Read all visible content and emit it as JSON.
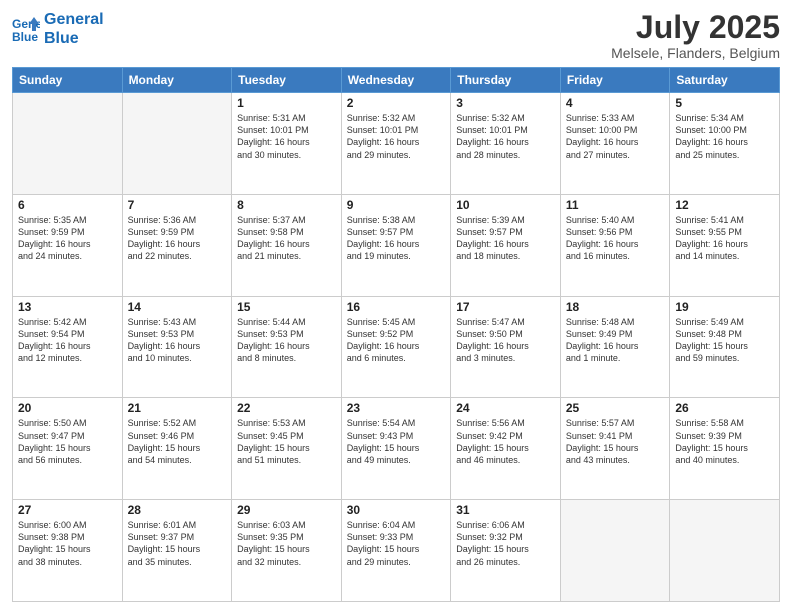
{
  "header": {
    "logo_line1": "General",
    "logo_line2": "Blue",
    "month": "July 2025",
    "location": "Melsele, Flanders, Belgium"
  },
  "weekdays": [
    "Sunday",
    "Monday",
    "Tuesday",
    "Wednesday",
    "Thursday",
    "Friday",
    "Saturday"
  ],
  "weeks": [
    [
      {
        "day": "",
        "info": ""
      },
      {
        "day": "",
        "info": ""
      },
      {
        "day": "1",
        "info": "Sunrise: 5:31 AM\nSunset: 10:01 PM\nDaylight: 16 hours\nand 30 minutes."
      },
      {
        "day": "2",
        "info": "Sunrise: 5:32 AM\nSunset: 10:01 PM\nDaylight: 16 hours\nand 29 minutes."
      },
      {
        "day": "3",
        "info": "Sunrise: 5:32 AM\nSunset: 10:01 PM\nDaylight: 16 hours\nand 28 minutes."
      },
      {
        "day": "4",
        "info": "Sunrise: 5:33 AM\nSunset: 10:00 PM\nDaylight: 16 hours\nand 27 minutes."
      },
      {
        "day": "5",
        "info": "Sunrise: 5:34 AM\nSunset: 10:00 PM\nDaylight: 16 hours\nand 25 minutes."
      }
    ],
    [
      {
        "day": "6",
        "info": "Sunrise: 5:35 AM\nSunset: 9:59 PM\nDaylight: 16 hours\nand 24 minutes."
      },
      {
        "day": "7",
        "info": "Sunrise: 5:36 AM\nSunset: 9:59 PM\nDaylight: 16 hours\nand 22 minutes."
      },
      {
        "day": "8",
        "info": "Sunrise: 5:37 AM\nSunset: 9:58 PM\nDaylight: 16 hours\nand 21 minutes."
      },
      {
        "day": "9",
        "info": "Sunrise: 5:38 AM\nSunset: 9:57 PM\nDaylight: 16 hours\nand 19 minutes."
      },
      {
        "day": "10",
        "info": "Sunrise: 5:39 AM\nSunset: 9:57 PM\nDaylight: 16 hours\nand 18 minutes."
      },
      {
        "day": "11",
        "info": "Sunrise: 5:40 AM\nSunset: 9:56 PM\nDaylight: 16 hours\nand 16 minutes."
      },
      {
        "day": "12",
        "info": "Sunrise: 5:41 AM\nSunset: 9:55 PM\nDaylight: 16 hours\nand 14 minutes."
      }
    ],
    [
      {
        "day": "13",
        "info": "Sunrise: 5:42 AM\nSunset: 9:54 PM\nDaylight: 16 hours\nand 12 minutes."
      },
      {
        "day": "14",
        "info": "Sunrise: 5:43 AM\nSunset: 9:53 PM\nDaylight: 16 hours\nand 10 minutes."
      },
      {
        "day": "15",
        "info": "Sunrise: 5:44 AM\nSunset: 9:53 PM\nDaylight: 16 hours\nand 8 minutes."
      },
      {
        "day": "16",
        "info": "Sunrise: 5:45 AM\nSunset: 9:52 PM\nDaylight: 16 hours\nand 6 minutes."
      },
      {
        "day": "17",
        "info": "Sunrise: 5:47 AM\nSunset: 9:50 PM\nDaylight: 16 hours\nand 3 minutes."
      },
      {
        "day": "18",
        "info": "Sunrise: 5:48 AM\nSunset: 9:49 PM\nDaylight: 16 hours\nand 1 minute."
      },
      {
        "day": "19",
        "info": "Sunrise: 5:49 AM\nSunset: 9:48 PM\nDaylight: 15 hours\nand 59 minutes."
      }
    ],
    [
      {
        "day": "20",
        "info": "Sunrise: 5:50 AM\nSunset: 9:47 PM\nDaylight: 15 hours\nand 56 minutes."
      },
      {
        "day": "21",
        "info": "Sunrise: 5:52 AM\nSunset: 9:46 PM\nDaylight: 15 hours\nand 54 minutes."
      },
      {
        "day": "22",
        "info": "Sunrise: 5:53 AM\nSunset: 9:45 PM\nDaylight: 15 hours\nand 51 minutes."
      },
      {
        "day": "23",
        "info": "Sunrise: 5:54 AM\nSunset: 9:43 PM\nDaylight: 15 hours\nand 49 minutes."
      },
      {
        "day": "24",
        "info": "Sunrise: 5:56 AM\nSunset: 9:42 PM\nDaylight: 15 hours\nand 46 minutes."
      },
      {
        "day": "25",
        "info": "Sunrise: 5:57 AM\nSunset: 9:41 PM\nDaylight: 15 hours\nand 43 minutes."
      },
      {
        "day": "26",
        "info": "Sunrise: 5:58 AM\nSunset: 9:39 PM\nDaylight: 15 hours\nand 40 minutes."
      }
    ],
    [
      {
        "day": "27",
        "info": "Sunrise: 6:00 AM\nSunset: 9:38 PM\nDaylight: 15 hours\nand 38 minutes."
      },
      {
        "day": "28",
        "info": "Sunrise: 6:01 AM\nSunset: 9:37 PM\nDaylight: 15 hours\nand 35 minutes."
      },
      {
        "day": "29",
        "info": "Sunrise: 6:03 AM\nSunset: 9:35 PM\nDaylight: 15 hours\nand 32 minutes."
      },
      {
        "day": "30",
        "info": "Sunrise: 6:04 AM\nSunset: 9:33 PM\nDaylight: 15 hours\nand 29 minutes."
      },
      {
        "day": "31",
        "info": "Sunrise: 6:06 AM\nSunset: 9:32 PM\nDaylight: 15 hours\nand 26 minutes."
      },
      {
        "day": "",
        "info": ""
      },
      {
        "day": "",
        "info": ""
      }
    ]
  ]
}
